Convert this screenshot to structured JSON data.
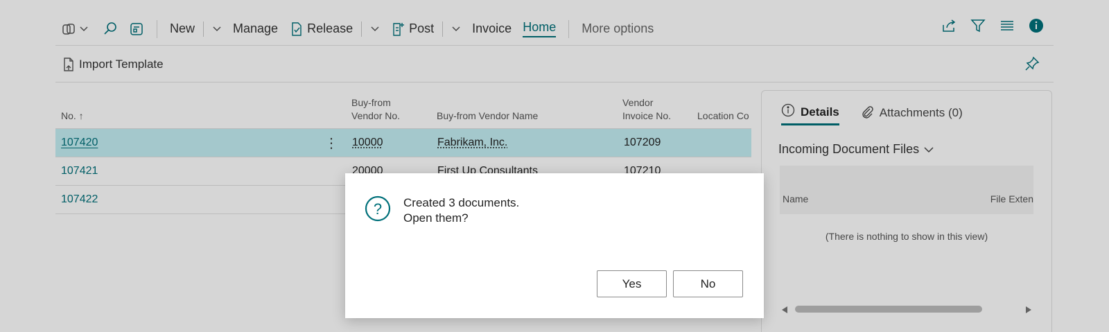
{
  "toolbar": {
    "new_label": "New",
    "manage_label": "Manage",
    "release_label": "Release",
    "post_label": "Post",
    "invoice_label": "Invoice",
    "home_label": "Home",
    "more_options_label": "More options"
  },
  "actionbar": {
    "import_template_label": "Import Template"
  },
  "list": {
    "columns": {
      "no": "No. ↑",
      "vendor_no_1": "Buy-from",
      "vendor_no_2": "Vendor No.",
      "vendor_name": "Buy-from Vendor Name",
      "invoice_no_1": "Vendor",
      "invoice_no_2": "Invoice No.",
      "location": "Location Co"
    },
    "rows": [
      {
        "no": "107420",
        "vendor_no": "10000",
        "vendor_name": "Fabrikam, Inc.",
        "invoice_no": "107209"
      },
      {
        "no": "107421",
        "vendor_no": "20000",
        "vendor_name": "First Up Consultants",
        "invoice_no": "107210"
      },
      {
        "no": "107422",
        "vendor_no": "",
        "vendor_name": "",
        "invoice_no": ""
      }
    ]
  },
  "factbox": {
    "tab_details": "Details",
    "tab_attachments": "Attachments (0)",
    "section_title": "Incoming Document Files",
    "col_name": "Name",
    "col_ext": "File Exten",
    "empty_text": "(There is nothing to show in this view)"
  },
  "dialog": {
    "line1": "Created 3 documents.",
    "line2": "Open them?",
    "yes_label": "Yes",
    "no_label": "No"
  },
  "colors": {
    "accent": "#00707a",
    "selected_row": "#c4eff4"
  }
}
